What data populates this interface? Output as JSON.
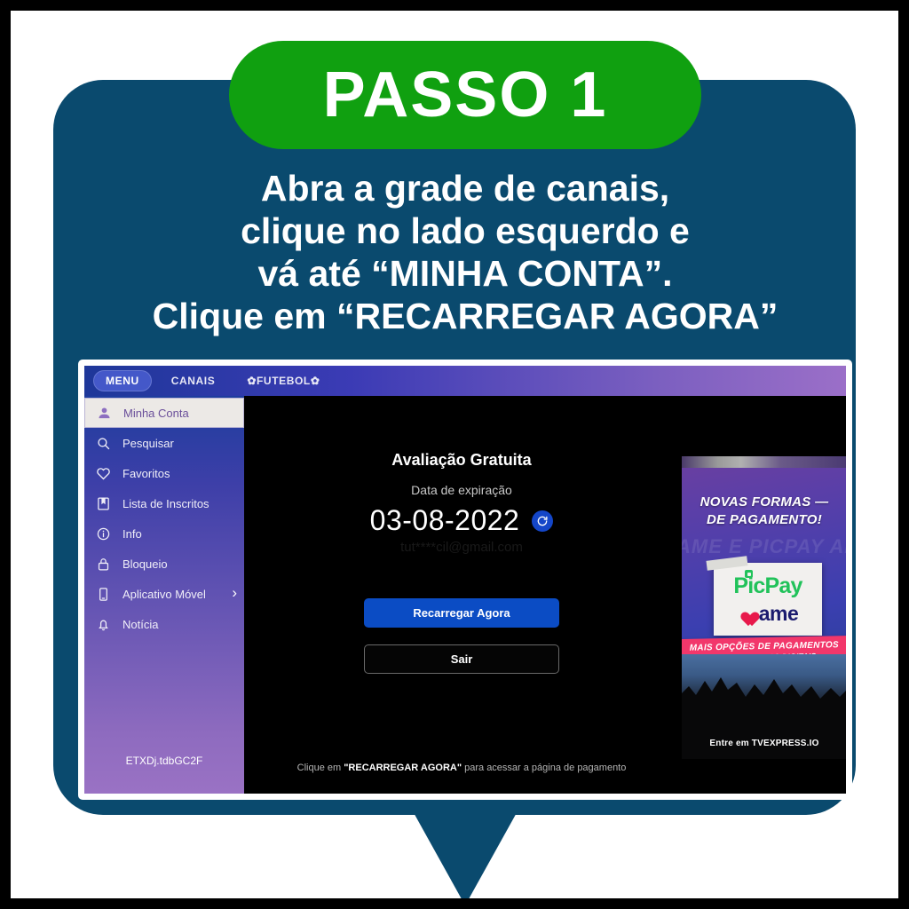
{
  "step_badge": {
    "label": "PASSO 1"
  },
  "instructions": {
    "line1": "Abra a grade de canais,",
    "line2": "clique no lado esquerdo e",
    "line3": "vá até “MINHA CONTA”.",
    "line4": "Clique em “RECARREGAR AGORA”"
  },
  "app": {
    "topbar": {
      "items": [
        {
          "label": "MENU",
          "selected": true
        },
        {
          "label": "CANAIS",
          "selected": false
        },
        {
          "label": "✿FUTEBOL✿",
          "selected": false
        }
      ]
    },
    "sidebar": {
      "items": [
        {
          "label": "Minha Conta",
          "icon": "person-icon",
          "active": true
        },
        {
          "label": "Pesquisar",
          "icon": "search-icon",
          "active": false
        },
        {
          "label": "Favoritos",
          "icon": "heart-icon",
          "active": false
        },
        {
          "label": "Lista de Inscritos",
          "icon": "bookmark-icon",
          "active": false
        },
        {
          "label": "Info",
          "icon": "info-icon",
          "active": false
        },
        {
          "label": "Bloqueio",
          "icon": "lock-icon",
          "active": false
        },
        {
          "label": "Aplicativo Móvel",
          "icon": "mobile-icon",
          "active": false,
          "chevron": "›"
        },
        {
          "label": "Notícia",
          "icon": "bell-icon",
          "active": false
        }
      ],
      "device_code": "ETXDj.tdbGC2F"
    },
    "account": {
      "title": "Avaliação Gratuita",
      "expiration_label": "Data de expiração",
      "expiration_date": "03-08-2022",
      "refresh_icon": "refresh-icon",
      "email": "tut****cil@gmail.com",
      "recharge_button": "Recarregar Agora",
      "exit_button": "Sair",
      "hint_prefix": "Clique em ",
      "hint_emphasis": "\"RECARREGAR AGORA\"",
      "hint_suffix": " para acessar a página de pagamento"
    },
    "promo": {
      "headline_line1": "NOVAS FORMAS —",
      "headline_line2": "DE PAGAMENTO!",
      "watermark": "AME E PICPAY AME E PICPAY AME E PICPAY",
      "picpay_logo": "PicPay",
      "ame_logo": "ame",
      "banner_line1": "MAIS OPÇÕES DE PAGAMENTOS",
      "banner_line2": "COM CARTEIRAS DIGITAIS",
      "footer": "Entre em TVEXPRESS.IO"
    }
  },
  "colors": {
    "badge_green": "#10a010",
    "bubble_navy": "#0a4a6e",
    "accent_blue": "#0b4cc4",
    "picpay_green": "#21c25a",
    "ame_navy": "#1b1b6e",
    "banner_pink": "#f2376b"
  }
}
